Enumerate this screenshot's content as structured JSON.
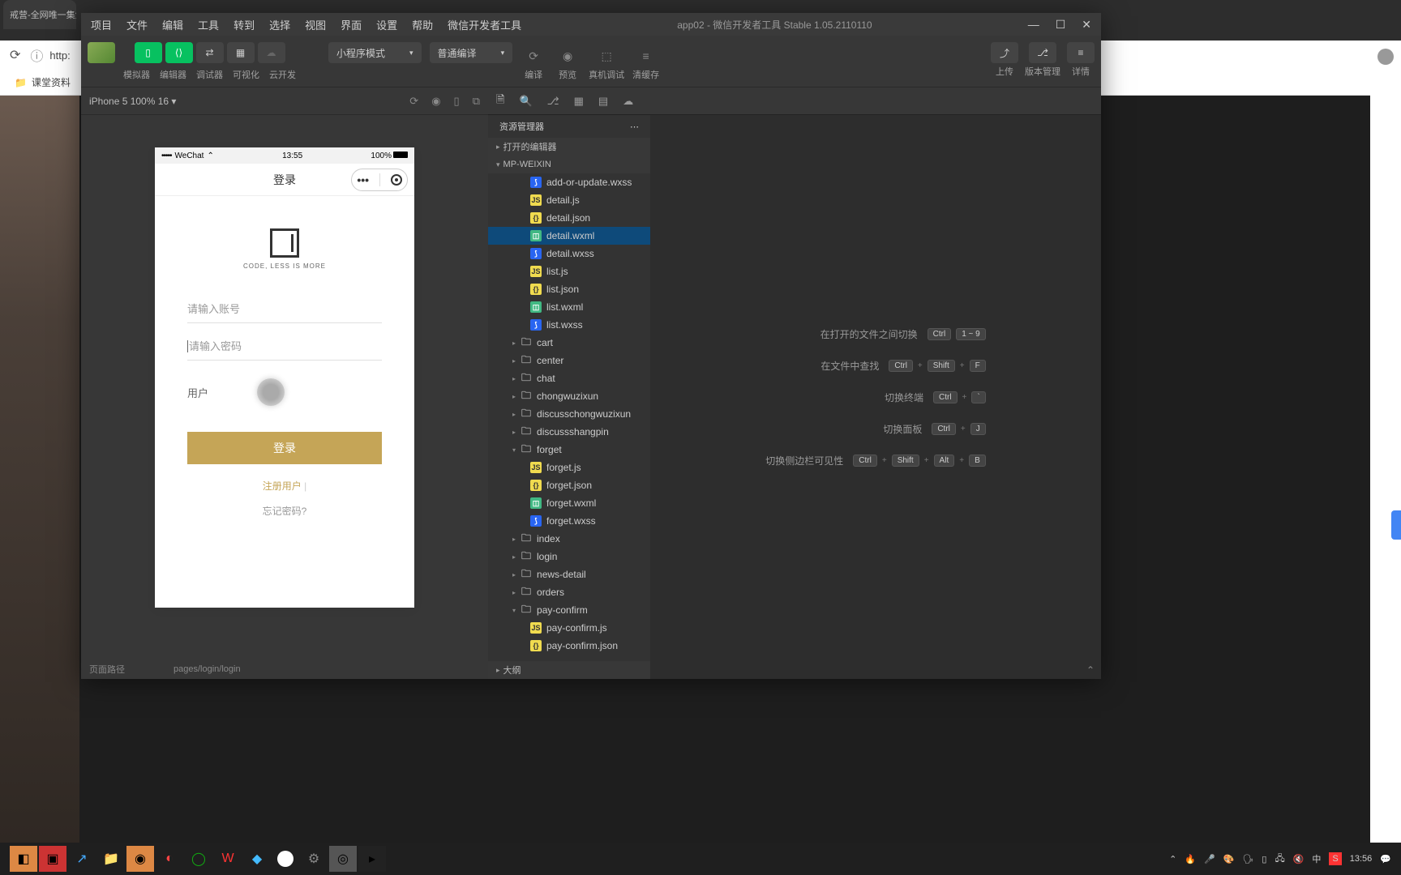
{
  "browser": {
    "tab_title": "戒营-全网唯一集免费",
    "url_prefix": "http:",
    "bookmark": "课堂资料"
  },
  "ide": {
    "menu": [
      "项目",
      "文件",
      "编辑",
      "工具",
      "转到",
      "选择",
      "视图",
      "界面",
      "设置",
      "帮助",
      "微信开发者工具"
    ],
    "title": "app02 - 微信开发者工具 Stable 1.05.2110110",
    "toolbar": {
      "tabs": [
        "模拟器",
        "编辑器",
        "调试器",
        "可视化",
        "云开发"
      ],
      "dropdown1": "小程序模式",
      "dropdown2": "普通编译",
      "actions": [
        "编译",
        "预览",
        "真机调试",
        "清缓存"
      ],
      "right_actions": [
        "上传",
        "版本管理",
        "详情"
      ]
    },
    "simulator": {
      "device": "iPhone 5 100% 16 ▾",
      "phone": {
        "time": "13:55",
        "carrier": "WeChat",
        "battery": "100%",
        "nav_title": "登录",
        "logo_text": "CODE, LESS IS MORE",
        "placeholder_user": "请输入账号",
        "placeholder_pwd": "请输入密码",
        "user_label": "用户",
        "login_btn": "登录",
        "register": "注册用户",
        "forgot": "忘记密码?"
      },
      "footer_left": "页面路径",
      "footer_path": "pages/login/login"
    },
    "explorer": {
      "title": "资源管理器",
      "section1": "打开的编辑器",
      "section2": "MP-WEIXIN",
      "outline": "大纲",
      "files": [
        {
          "name": "add-or-update.wxss",
          "type": "wxss"
        },
        {
          "name": "detail.js",
          "type": "js"
        },
        {
          "name": "detail.json",
          "type": "json"
        },
        {
          "name": "detail.wxml",
          "type": "wxml",
          "selected": true
        },
        {
          "name": "detail.wxss",
          "type": "wxss"
        },
        {
          "name": "list.js",
          "type": "js"
        },
        {
          "name": "list.json",
          "type": "json"
        },
        {
          "name": "list.wxml",
          "type": "wxml"
        },
        {
          "name": "list.wxss",
          "type": "wxss"
        }
      ],
      "folders": [
        {
          "name": "cart",
          "open": false
        },
        {
          "name": "center",
          "open": false
        },
        {
          "name": "chat",
          "open": false
        },
        {
          "name": "chongwuzixun",
          "open": false
        },
        {
          "name": "discusschongwuzixun",
          "open": false
        },
        {
          "name": "discussshangpin",
          "open": false
        },
        {
          "name": "forget",
          "open": true,
          "children": [
            {
              "name": "forget.js",
              "type": "js"
            },
            {
              "name": "forget.json",
              "type": "json"
            },
            {
              "name": "forget.wxml",
              "type": "wxml"
            },
            {
              "name": "forget.wxss",
              "type": "wxss"
            }
          ]
        },
        {
          "name": "index",
          "open": false
        },
        {
          "name": "login",
          "open": false
        },
        {
          "name": "news-detail",
          "open": false
        },
        {
          "name": "orders",
          "open": false
        },
        {
          "name": "pay-confirm",
          "open": true,
          "children": [
            {
              "name": "pay-confirm.js",
              "type": "js"
            },
            {
              "name": "pay-confirm.json",
              "type": "json"
            }
          ]
        }
      ]
    },
    "shortcuts": [
      {
        "label": "在打开的文件之间切换",
        "keys": [
          "Ctrl",
          "1 ~ 9"
        ]
      },
      {
        "label": "在文件中查找",
        "keys": [
          "Ctrl",
          "+",
          "Shift",
          "+",
          "F"
        ]
      },
      {
        "label": "切换终端",
        "keys": [
          "Ctrl",
          "+",
          "`"
        ]
      },
      {
        "label": "切换面板",
        "keys": [
          "Ctrl",
          "+",
          "J"
        ]
      },
      {
        "label": "切换侧边栏可见性",
        "keys": [
          "Ctrl",
          "+",
          "Shift",
          "+",
          "Alt",
          "+",
          "B"
        ]
      }
    ]
  },
  "taskbar": {
    "ime": "中",
    "time": "13:56"
  }
}
